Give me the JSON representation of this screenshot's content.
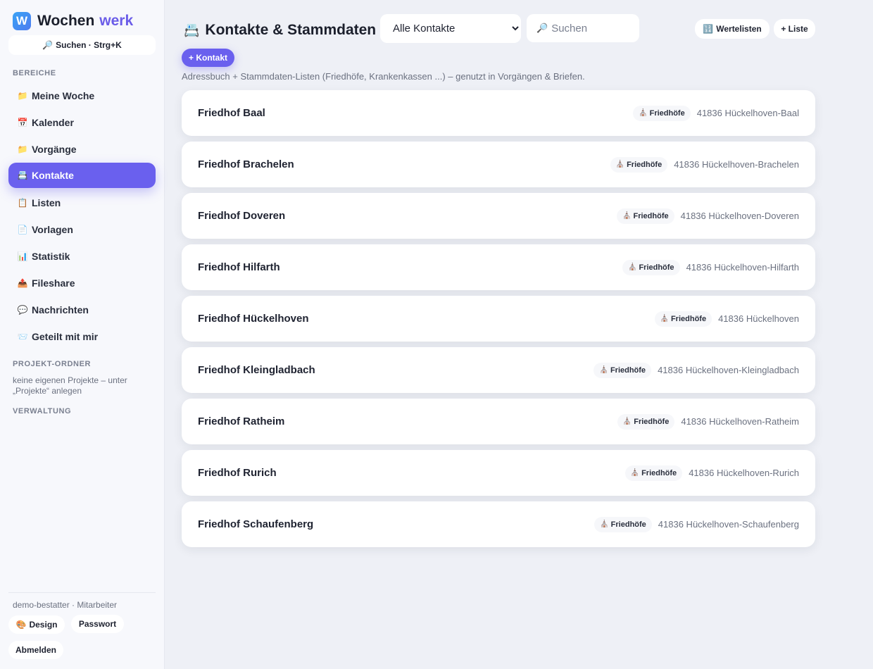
{
  "app": {
    "logo_letter": "W",
    "brand_part1": "Wochen",
    "brand_part2": "werk",
    "search_label": "Suchen · Strg+K",
    "search_icon": "🔎"
  },
  "sidebar": {
    "section_areas": "BEREICHE",
    "items": [
      {
        "label": "Meine Woche",
        "icon": "📁"
      },
      {
        "label": "Kalender",
        "icon": "📅"
      },
      {
        "label": "Vorgänge",
        "icon": "📁"
      },
      {
        "label": "Kontakte",
        "icon": "📇"
      },
      {
        "label": "Listen",
        "icon": "📋"
      },
      {
        "label": "Vorlagen",
        "icon": "📄"
      },
      {
        "label": "Statistik",
        "icon": "📊"
      },
      {
        "label": "Fileshare",
        "icon": "📤"
      },
      {
        "label": "Nachrichten",
        "icon": "💬"
      },
      {
        "label": "Geteilt mit mir",
        "icon": "📨"
      }
    ],
    "active_index": 3,
    "section_projects": "PROJEKT-ORDNER",
    "projects_empty_text": "keine eigenen Projekte – unter „Projekte“ anlegen",
    "section_admin": "VERWALTUNG",
    "user_line": "demo-bestatter · Mitarbeiter",
    "design_label": "Design",
    "design_icon": "🎨",
    "password_label": "Passwort",
    "logout_label": "Abmelden"
  },
  "header": {
    "title": "Kontakte & Stammdaten",
    "title_icon": "📇",
    "filter_options": [
      "Alle Kontakte"
    ],
    "filter_selected": "Alle Kontakte",
    "search_placeholder": "Suchen",
    "search_icon": "🔎",
    "value_lists_label": "Wertelisten",
    "value_lists_icon": "🔢",
    "add_list_label": "+ Liste",
    "add_contact_label": "+ Kontakt",
    "subtitle": "Adressbuch + Stammdaten-Listen (Friedhöfe, Krankenkassen ...) – genutzt in Vorgängen & Briefen."
  },
  "contacts": [
    {
      "name": "Friedhof Baal",
      "tag": "Friedhöfe",
      "tag_icon": "⛪",
      "city": "41836 Hückelhoven-Baal"
    },
    {
      "name": "Friedhof Brachelen",
      "tag": "Friedhöfe",
      "tag_icon": "⛪",
      "city": "41836 Hückelhoven-Brachelen"
    },
    {
      "name": "Friedhof Doveren",
      "tag": "Friedhöfe",
      "tag_icon": "⛪",
      "city": "41836 Hückelhoven-Doveren"
    },
    {
      "name": "Friedhof Hilfarth",
      "tag": "Friedhöfe",
      "tag_icon": "⛪",
      "city": "41836 Hückelhoven-Hilfarth"
    },
    {
      "name": "Friedhof Hückelhoven",
      "tag": "Friedhöfe",
      "tag_icon": "⛪",
      "city": "41836 Hückelhoven"
    },
    {
      "name": "Friedhof Kleingladbach",
      "tag": "Friedhöfe",
      "tag_icon": "⛪",
      "city": "41836 Hückelhoven-Kleingladbach"
    },
    {
      "name": "Friedhof Ratheim",
      "tag": "Friedhöfe",
      "tag_icon": "⛪",
      "city": "41836 Hückelhoven-Ratheim"
    },
    {
      "name": "Friedhof Rurich",
      "tag": "Friedhöfe",
      "tag_icon": "⛪",
      "city": "41836 Hückelhoven-Rurich"
    },
    {
      "name": "Friedhof Schaufenberg",
      "tag": "Friedhöfe",
      "tag_icon": "⛪",
      "city": "41836 Hückelhoven-Schaufenberg"
    }
  ],
  "colors": {
    "accent": "#6a60ee",
    "brand_secondary": "#6a5ce8",
    "logo": "#3aa3f5"
  }
}
